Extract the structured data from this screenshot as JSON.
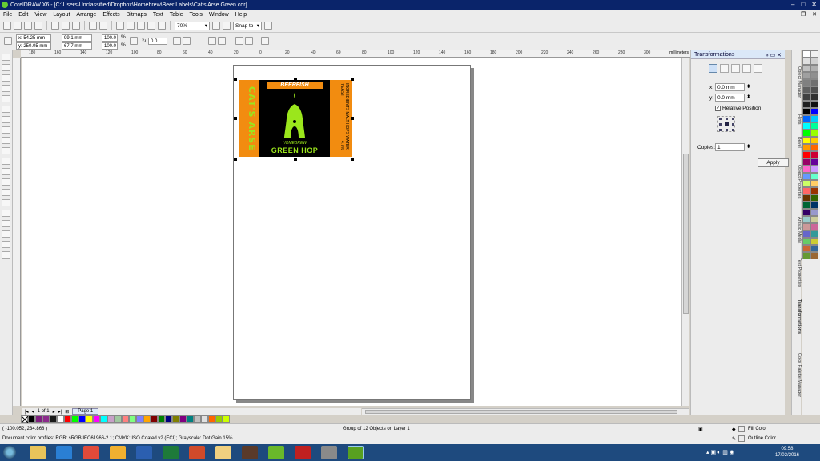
{
  "window": {
    "title": "CorelDRAW X6 - [C:\\Users\\Unclassified\\Dropbox\\Homebrew\\Beer Labels\\Cat's Arse Green.cdr]"
  },
  "menu": [
    "File",
    "Edit",
    "View",
    "Layout",
    "Arrange",
    "Effects",
    "Bitmaps",
    "Text",
    "Table",
    "Tools",
    "Window",
    "Help"
  ],
  "toolbar": {
    "zoom": "70%",
    "snap_to": "Snap to"
  },
  "props": {
    "x": "x: 54.25 mm",
    "y": "y: 250.05 mm",
    "w": "99.1 mm",
    "h": "67.7 mm",
    "scale_x": "100.0",
    "scale_y": "100.0",
    "pct1": "%",
    "pct2": "%",
    "angle": "0.0"
  },
  "ruler": {
    "unit": "millimeters",
    "ticks": [
      "180",
      "160",
      "140",
      "120",
      "100",
      "80",
      "60",
      "40",
      "20",
      "0",
      "20",
      "40",
      "60",
      "80",
      "100",
      "120",
      "140",
      "160",
      "180",
      "200",
      "220",
      "240",
      "260",
      "280",
      "300"
    ]
  },
  "label": {
    "left_text": "CAT'S ARSE",
    "brand": "BEERFISH",
    "small_text": "HOMEBREW",
    "main_text": "GREEN HOP",
    "right_text": "INGREDIENTS MALT HOPS WATER YEAST",
    "right_num": "4.7%",
    "colors": {
      "orange": "#f28c10",
      "green": "#9be61c",
      "black": "#000000"
    }
  },
  "page_nav": {
    "count": "1 of 1",
    "tab": "Page 1"
  },
  "docker": {
    "title": "Transformations",
    "x_label": "x:",
    "x_value": "0.0 mm",
    "y_label": "y:",
    "y_value": "0.0 mm",
    "relative": "Relative Position",
    "copies_label": "Copies:",
    "copies_value": "1",
    "apply": "Apply"
  },
  "side_tabs": [
    "Object Manager",
    "Hints",
    "Bevel",
    "Object Properties",
    "Artistic Media",
    "Text Properties",
    "Transformations",
    "Color Palette Manager"
  ],
  "status": {
    "coords": "( -100.052, 234.868 )",
    "selection": "Group of 12 Objects on Layer 1",
    "profiles": "Document color profiles: RGB: sRGB IEC61966-2.1; CMYK: ISO Coated v2 (ECI); Grayscale: Dot Gain 15%",
    "fill": "Fill Color",
    "outline": "Outline Color"
  },
  "clock": {
    "time": "09:58",
    "date": "17/02/2016"
  },
  "palette_colors": [
    "#000000",
    "#7f1f7f",
    "#8b2a8b",
    "#1a1a1a",
    "#ffffff",
    "#ff0000",
    "#00ff00",
    "#0000ff",
    "#ffff00",
    "#ff00ff",
    "#00ffff",
    "#c8a0c8",
    "#a0c8a0",
    "#ff8080",
    "#80ff80",
    "#8080ff",
    "#ffa500",
    "#800000",
    "#008000",
    "#000080",
    "#808000",
    "#800080",
    "#008080",
    "#c0c0c0",
    "#e0e0e0",
    "#ff6600",
    "#99cc00",
    "#ccff00"
  ],
  "vpalette_colors": [
    "#ffffff",
    "#f0f0f0",
    "#e0e0e0",
    "#d0d0d0",
    "#c0c0c0",
    "#b0b0b0",
    "#a0a0a0",
    "#909090",
    "#808080",
    "#707070",
    "#606060",
    "#505050",
    "#404040",
    "#303030",
    "#202020",
    "#101010",
    "#000000",
    "#0000ff",
    "#0066ff",
    "#00ccff",
    "#00ffff",
    "#00ff99",
    "#00ff00",
    "#99ff00",
    "#ffff00",
    "#ffcc00",
    "#ff9900",
    "#ff6600",
    "#ff0000",
    "#cc0033",
    "#990066",
    "#660099",
    "#ff66cc",
    "#cc99ff",
    "#6699ff",
    "#66ffcc",
    "#ccff66",
    "#ffcc66",
    "#ff6666",
    "#993300",
    "#663300",
    "#336600",
    "#006633",
    "#003366",
    "#330066",
    "#9999cc",
    "#99cccc",
    "#cccc99",
    "#cc9999",
    "#cc6699",
    "#6666cc",
    "#339999",
    "#66cc66",
    "#cccc33",
    "#cc6633",
    "#336699",
    "#669933",
    "#996633"
  ]
}
